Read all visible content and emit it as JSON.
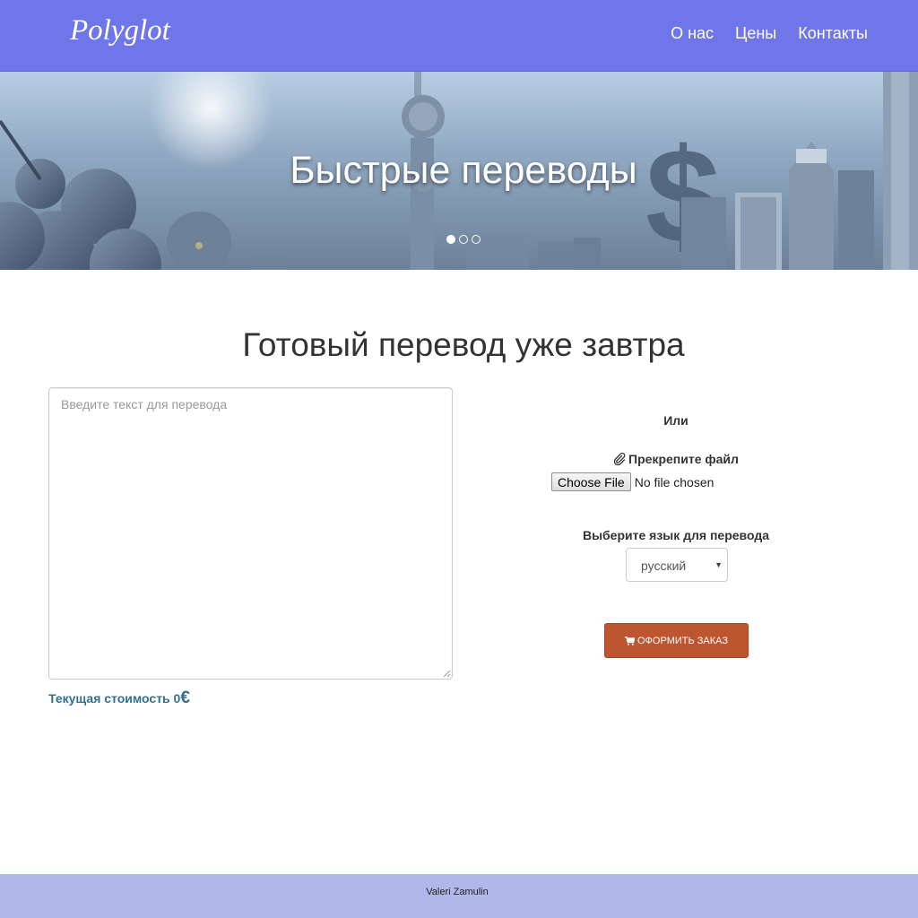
{
  "navbar": {
    "brand": "Polyglot",
    "links": [
      {
        "label": "О нас"
      },
      {
        "label": "Цены"
      },
      {
        "label": "Контакты"
      }
    ]
  },
  "hero": {
    "title": "Быстрые переводы",
    "slide_count": 3,
    "active_slide": 1
  },
  "main": {
    "heading": "Готовый перевод уже завтра",
    "text_input": {
      "value": "",
      "placeholder": "Введите текст для перевода"
    },
    "cost": {
      "label": "Текущая стоимость 0",
      "currency": "€"
    },
    "or_label": "Или",
    "attach": {
      "label": "Прекрепите файл",
      "icon": "paperclip-icon"
    },
    "file_input": {
      "button": "Choose File",
      "status": "No file chosen"
    },
    "language": {
      "label": "Выберите язык для перевода",
      "selected": "русский"
    },
    "order_button": {
      "label": "Оформить заказ",
      "icon": "cart-icon"
    }
  },
  "footer": {
    "text": "Valeri Zamulin"
  },
  "colors": {
    "navbar": "#6e76ea",
    "footer": "#b2b7ea",
    "order_button": "#bd5531",
    "cost_text": "#31708f"
  }
}
